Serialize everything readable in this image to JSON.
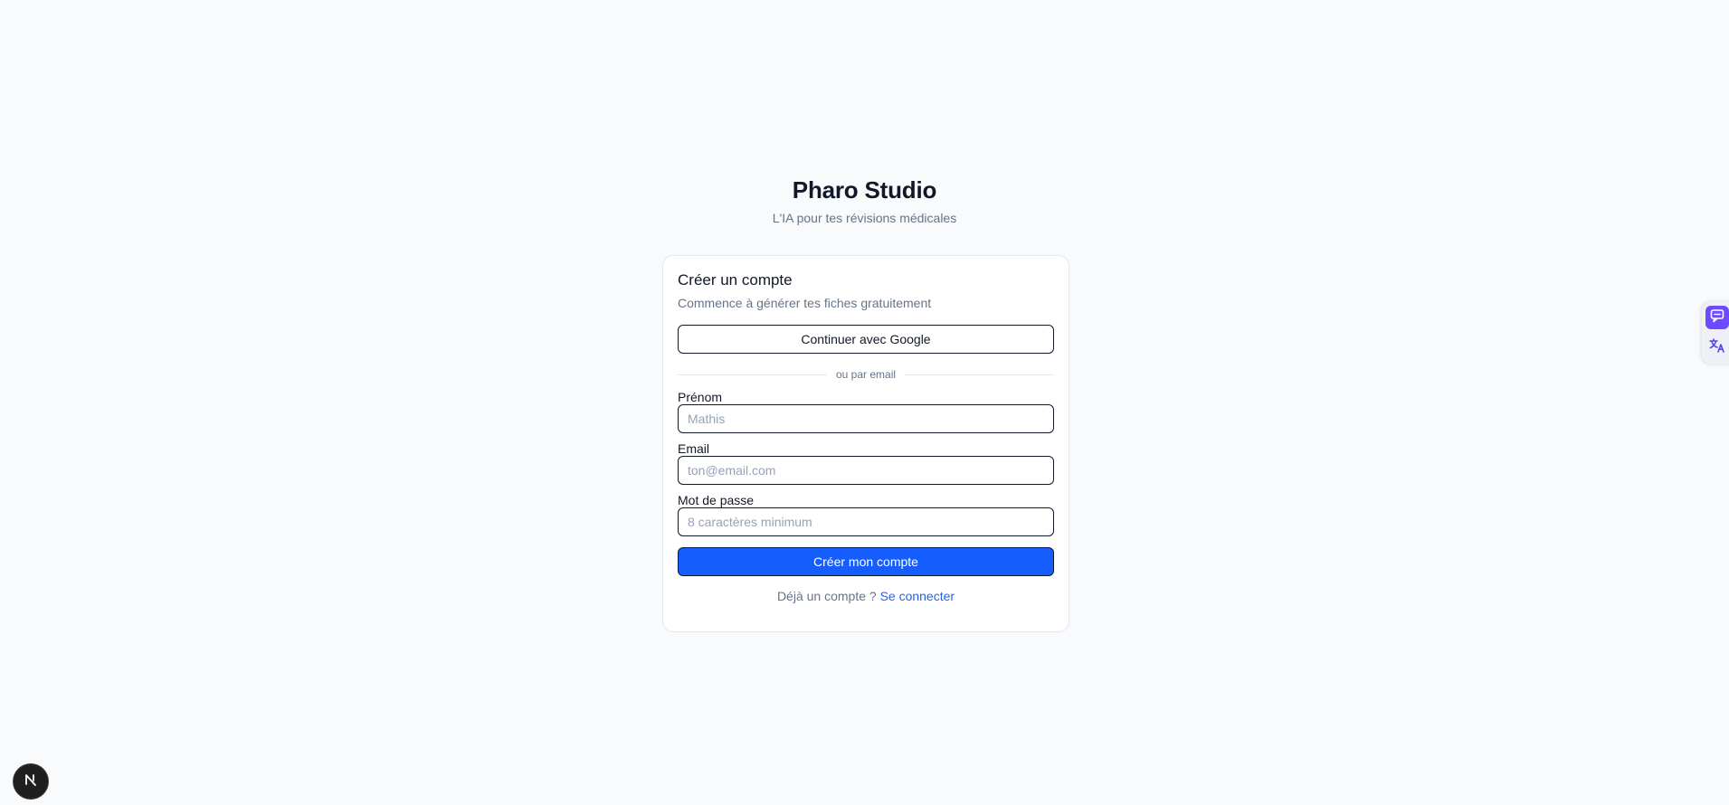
{
  "header": {
    "title": "Pharo Studio",
    "subtitle": "L'IA pour tes révisions médicales"
  },
  "card": {
    "title": "Créer un compte",
    "description": "Commence à générer tes fiches gratuitement",
    "google_button": "Continuer avec Google",
    "divider": "ou par email",
    "fields": {
      "first_name": {
        "label": "Prénom",
        "placeholder": "Mathis",
        "value": ""
      },
      "email": {
        "label": "Email",
        "placeholder": "ton@email.com",
        "value": ""
      },
      "password": {
        "label": "Mot de passe",
        "placeholder": "8 caractères minimum",
        "value": ""
      }
    },
    "submit_button": "Créer mon compte",
    "footer": {
      "prompt": "Déjà un compte ?",
      "link": "Se connecter"
    }
  },
  "badges": {
    "next_letter": "N"
  },
  "icons": {
    "next": "nextjs-logo-icon",
    "chat": "chat-extension-icon",
    "translate": "translate-extension-icon"
  },
  "colors": {
    "background": "#f8fafc",
    "primary": "#155dfc",
    "link": "#2563eb",
    "muted_text": "#64748b",
    "extension_accent": "#6d4aff"
  }
}
